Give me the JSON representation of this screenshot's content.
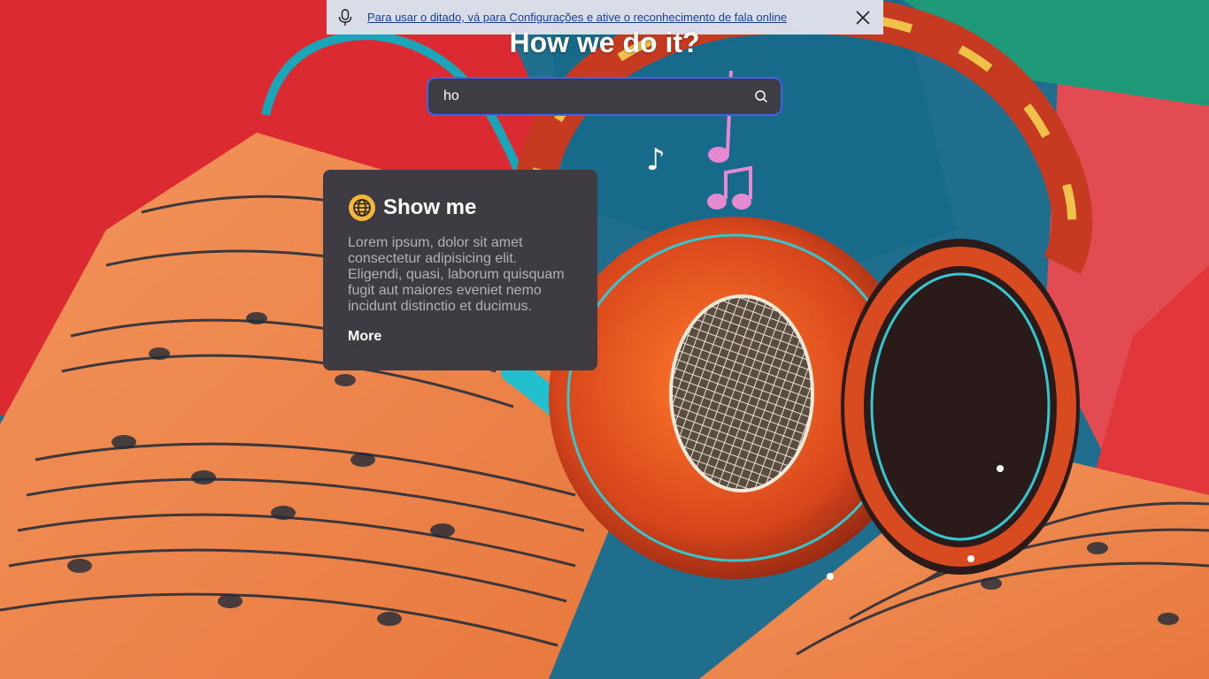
{
  "notification": {
    "text": "Para usar o ditado, vá para Configurações e ative o reconhecimento de fala online",
    "icon": "microphone-icon",
    "close_icon": "close-icon",
    "background": "#d8dde8",
    "link_color": "#1a3e9e"
  },
  "hero": {
    "title": "How we do it?"
  },
  "search": {
    "value": "ho",
    "icon": "search-icon",
    "border_color": "#3e63e8",
    "background": "#3f3d44"
  },
  "card": {
    "icon": "globe-icon",
    "icon_color": "#f4b73c",
    "title": "Show me",
    "body": "Lorem ipsum, dolor sit amet consectetur adipisicing elit. Eligendi, quasi, laborum quisquam fugit aut maiores eveniet nemo incidunt distinctio et ducimus.",
    "more_label": "More",
    "background": "#3e3c42"
  }
}
